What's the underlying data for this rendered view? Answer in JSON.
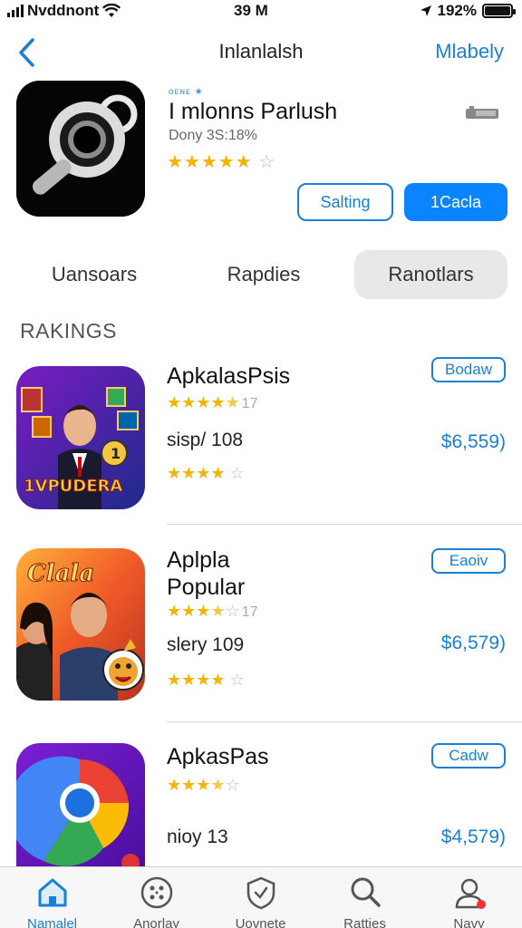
{
  "status": {
    "carrier": "Nvddnont",
    "time": "39 M",
    "battery": "192%"
  },
  "nav": {
    "title": "Inlanlalsh",
    "right": "Mlabely"
  },
  "hero": {
    "tag": "ᴏᴇɴᴇ ★",
    "title": "I mlonns Parlush",
    "subtitle": "Dony 3S:18%",
    "stars": 5,
    "button_outline": "Salting",
    "button_solid": "1Cacla"
  },
  "tabs": [
    "Uansoars",
    "Rapdies",
    "Ranotlars"
  ],
  "section": {
    "title": "RAKINGS"
  },
  "apps": [
    {
      "name": "ApkalasPsis",
      "rating_count": "17",
      "meta": "sisp/ 108",
      "price": "$6,559)",
      "button": "Bodaw"
    },
    {
      "name": "Aplpla Popular",
      "rating_count": "17",
      "meta": "slery 109",
      "price": "$6,579)",
      "button": "Eaoiv"
    },
    {
      "name": "ApkasPas",
      "rating_count": "",
      "meta": "nioy 13",
      "price": "$4,579)",
      "button": "Cadw"
    }
  ],
  "app_icon_text": {
    "first": "1VPUDERA",
    "second": "Clala"
  },
  "tabbar": [
    {
      "label": "Namalel",
      "icon": "home-icon",
      "active": true
    },
    {
      "label": "Anorlay",
      "icon": "grid-circle-icon",
      "active": false
    },
    {
      "label": "Uovnete",
      "icon": "shield-check-icon",
      "active": false
    },
    {
      "label": "Ratties",
      "icon": "search-icon",
      "active": false
    },
    {
      "label": "Navy",
      "icon": "person-icon",
      "active": false
    }
  ],
  "colors": {
    "accent": "#1a7fd6",
    "button_fill": "#0a84ff",
    "star": "#f5b400"
  }
}
